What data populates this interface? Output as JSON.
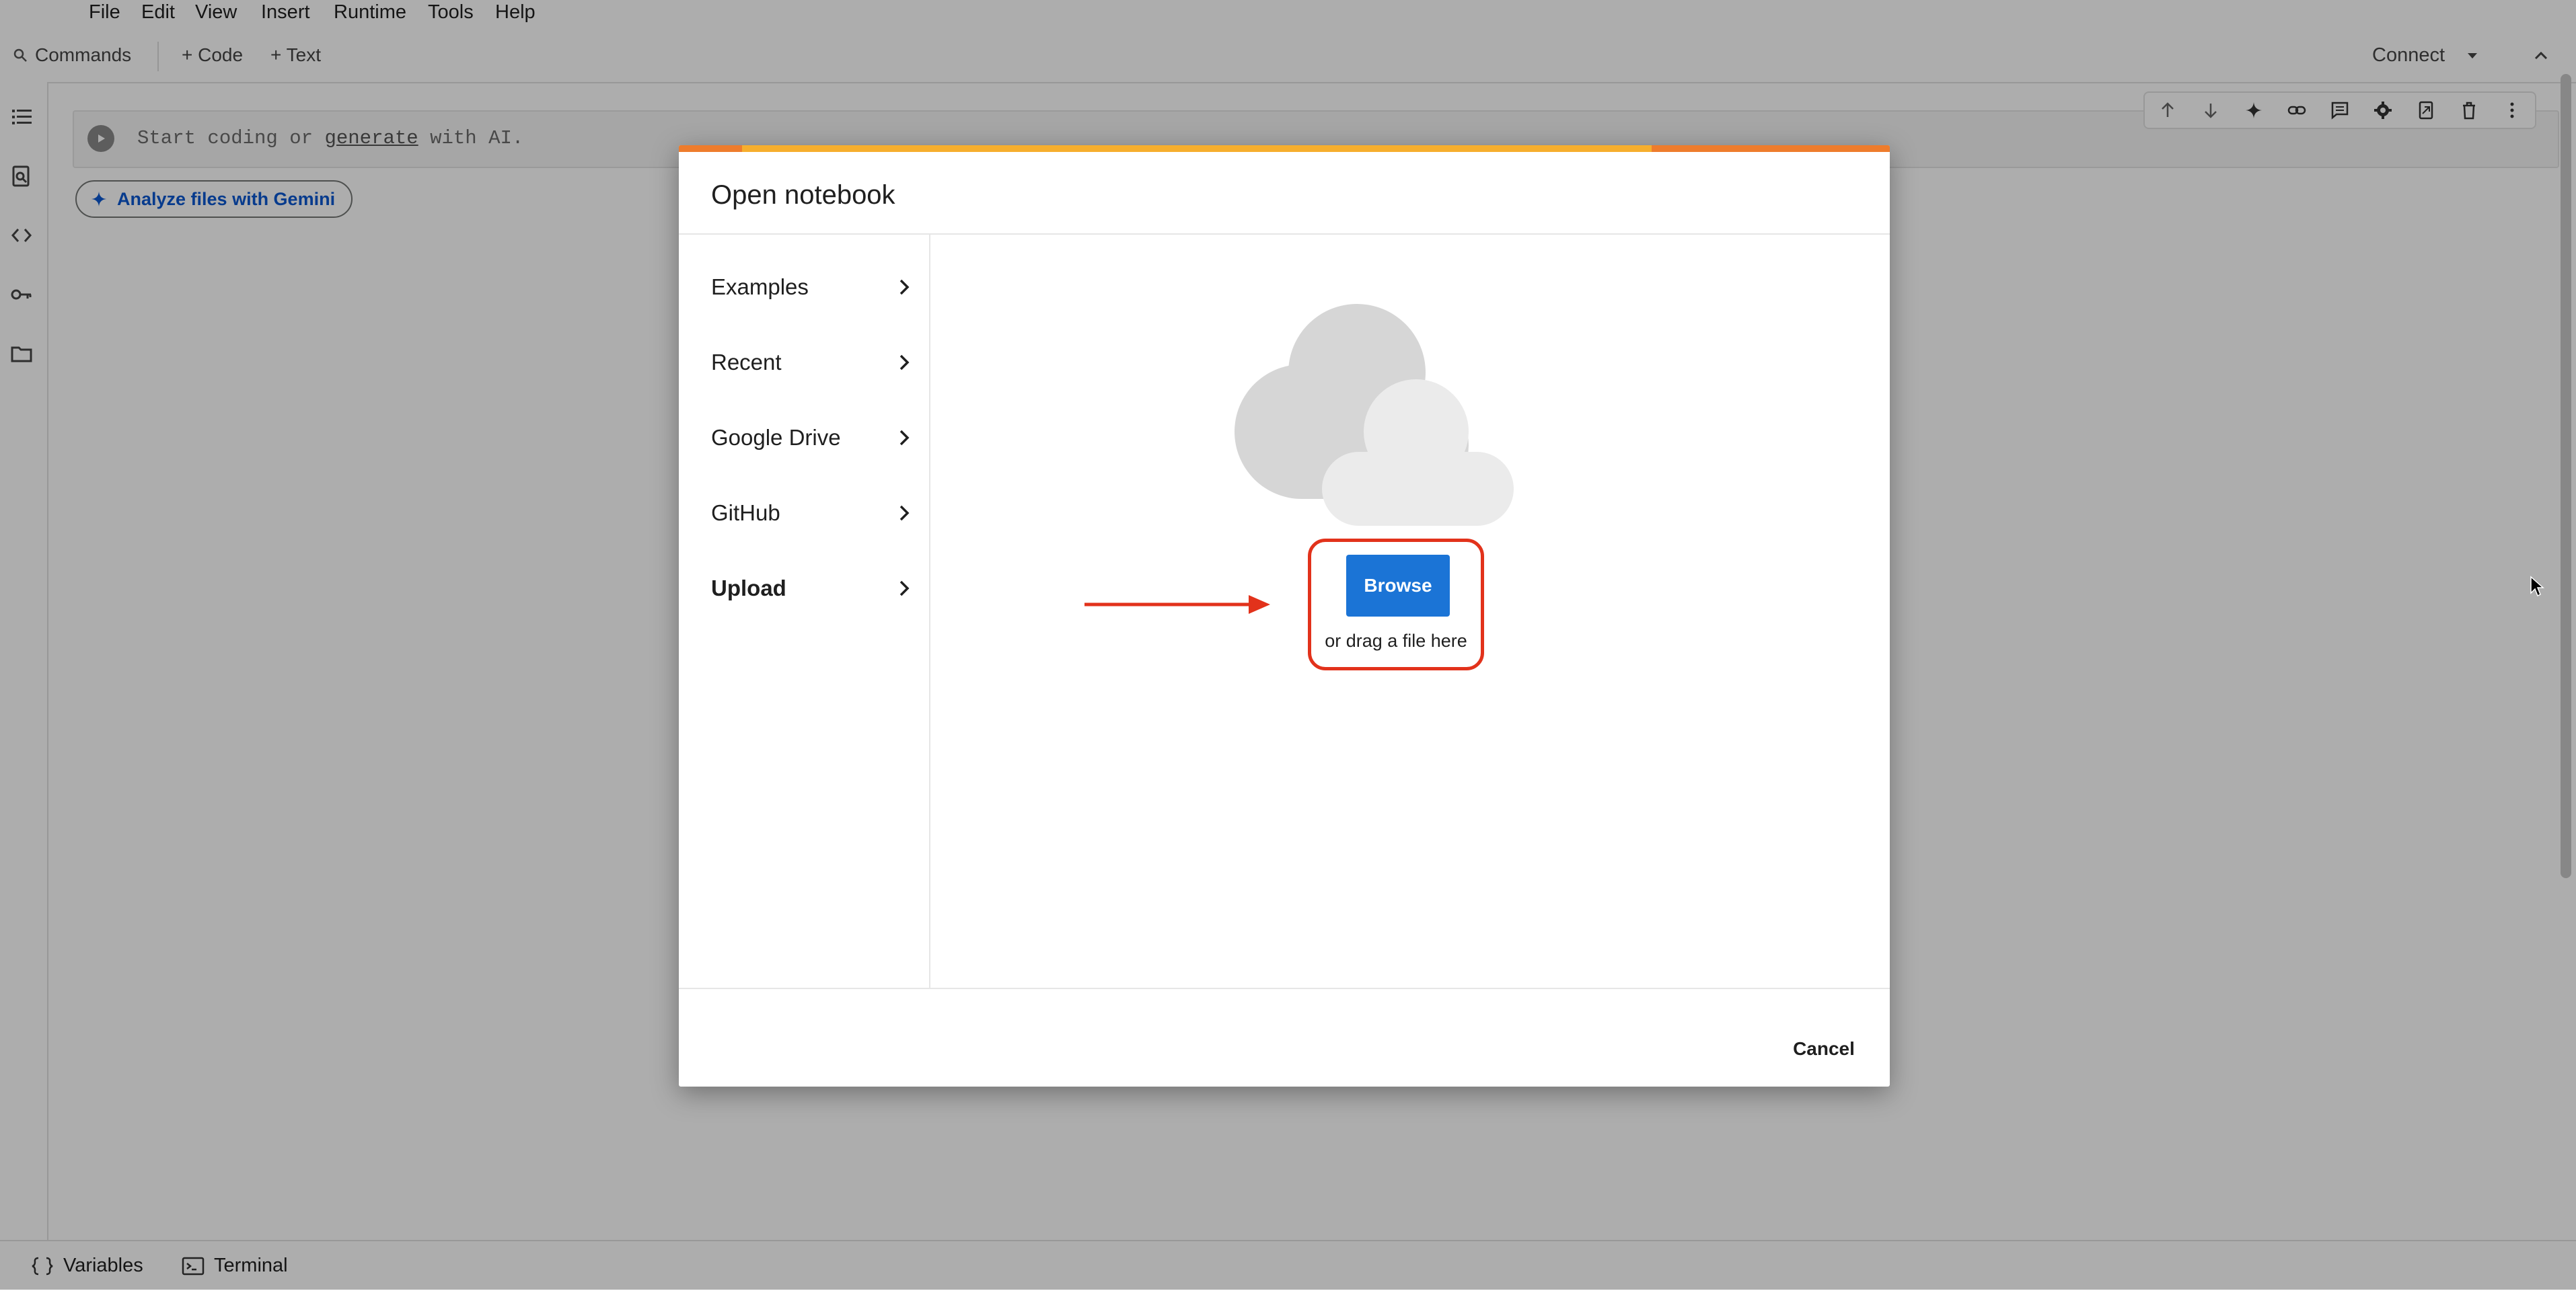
{
  "menu": {
    "items": [
      "File",
      "Edit",
      "View",
      "Insert",
      "Runtime",
      "Tools",
      "Help"
    ]
  },
  "toolbar": {
    "commands_label": "Commands",
    "code_label": "+ Code",
    "text_label": "+ Text",
    "connect_label": "Connect"
  },
  "cell": {
    "placeholder_prefix": "Start coding or ",
    "placeholder_link": "generate",
    "placeholder_suffix": " with AI."
  },
  "gemini_chip": {
    "label": "Analyze files with Gemini"
  },
  "bottom_bar": {
    "variables_label": "Variables",
    "terminal_label": "Terminal"
  },
  "dialog": {
    "title": "Open notebook",
    "sidebar_items": [
      {
        "label": "Examples",
        "active": false
      },
      {
        "label": "Recent",
        "active": false
      },
      {
        "label": "Google Drive",
        "active": false
      },
      {
        "label": "GitHub",
        "active": false
      },
      {
        "label": "Upload",
        "active": true
      }
    ],
    "browse_label": "Browse",
    "drag_text": "or drag a file here",
    "cancel_label": "Cancel"
  },
  "colors": {
    "accent_blue": "#1b74d6",
    "annotation_red": "#e2321b",
    "dialog_bar_orange": "#ee7c2c",
    "dialog_bar_yellow": "#f6ae2d",
    "gemini_blue": "#0b57d0"
  }
}
